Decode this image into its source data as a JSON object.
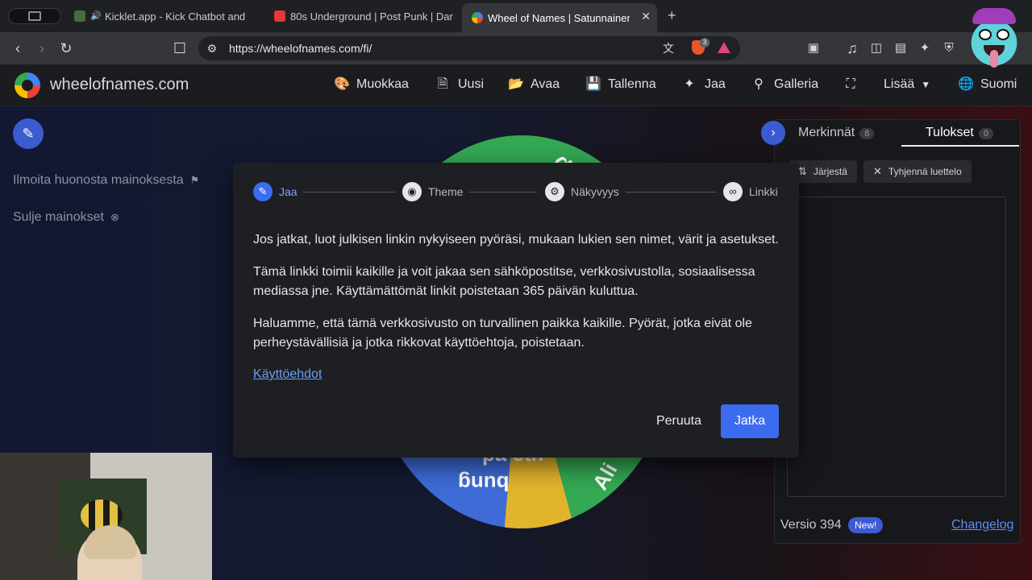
{
  "browser": {
    "tabs": [
      {
        "title": "Kicklet.app - Kick Chatbot and",
        "favicon_color": "#4a6b3a",
        "playing": true
      },
      {
        "title": "80s Underground | Post Punk | Dar",
        "favicon_color": "#e53935",
        "playing": false
      },
      {
        "title": "Wheel of Names | Satunnainen",
        "favicon_color": "#4285f4",
        "active": true
      }
    ],
    "new_tab": "+",
    "url": "https://wheelofnames.com/fi/",
    "brave_count": "3"
  },
  "site": {
    "brand": "wheelofnames.com",
    "nav": [
      {
        "label": "Muokkaa",
        "icon": "palette-icon"
      },
      {
        "label": "Uusi",
        "icon": "file-icon"
      },
      {
        "label": "Avaa",
        "icon": "folder-icon"
      },
      {
        "label": "Tallenna",
        "icon": "save-icon"
      },
      {
        "label": "Jaa",
        "icon": "share-icon"
      },
      {
        "label": "Galleria",
        "icon": "search-icon"
      },
      {
        "label": "Lisää",
        "icon": "fullscreen-icon"
      },
      {
        "label": "Suomi",
        "icon": "globe-icon"
      }
    ]
  },
  "left": {
    "report_ad": "Ilmoita huonosta mainoksesta",
    "close_ads": "Sulje mainokset"
  },
  "wheel": {
    "text_a": "pa etn",
    "text_b": "bung",
    "text_c": "Ali",
    "text_d": "d"
  },
  "right_panel": {
    "tab_entries": "Merkinnät",
    "tab_entries_count": "8",
    "tab_results": "Tulokset",
    "tab_results_count": "0",
    "sort_label": "Järjestä",
    "clear_label": "Tyhjennä luettelo",
    "version": "Versio 394",
    "new_badge": "New!",
    "changelog": "Changelog"
  },
  "modal": {
    "steps": [
      {
        "label": "Jaa",
        "icon": "pencil-icon"
      },
      {
        "label": "Theme",
        "icon": "palette-icon"
      },
      {
        "label": "Näkyvyys",
        "icon": "gear-icon"
      },
      {
        "label": "Linkki",
        "icon": "link-icon"
      }
    ],
    "para1": "Jos jatkat, luot julkisen linkin nykyiseen pyöräsi, mukaan lukien sen nimet, värit ja asetukset.",
    "para2": "Tämä linkki toimii kaikille ja voit jakaa sen sähköpostitse, verkkosivustolla, sosiaalisessa mediassa jne. Käyttämättömät linkit poistetaan 365 päivän kuluttua.",
    "para3": "Haluamme, että tämä verkkosivusto on turvallinen paikka kaikille. Pyörät, jotka eivät ole perheystävällisiä ja jotka rikkovat käyttöehtoja, poistetaan.",
    "terms_link": "Käyttöehdot",
    "cancel": "Peruuta",
    "continue": "Jatka"
  },
  "colors": {
    "accent": "#3b6cf0",
    "link": "#6a9cf5",
    "modal_bg": "#1e1f22"
  }
}
